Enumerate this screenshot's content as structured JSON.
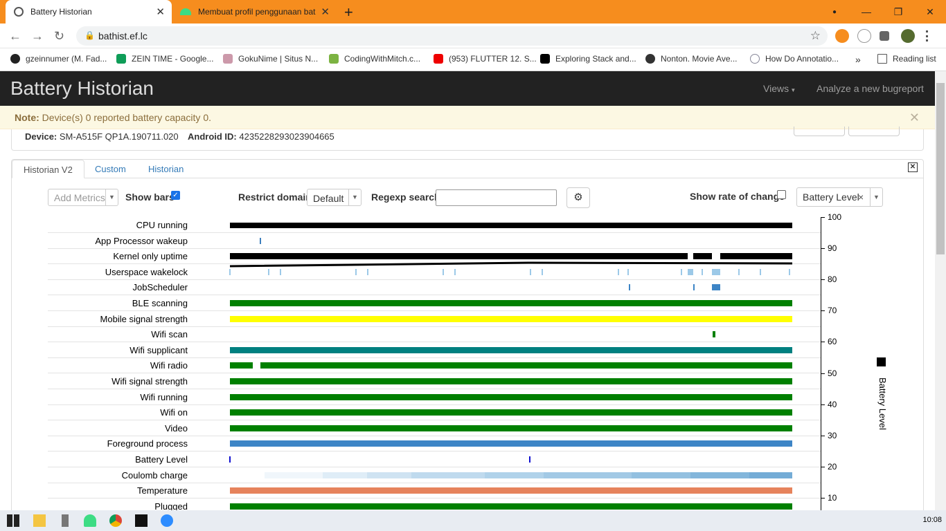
{
  "browser": {
    "tabs": [
      {
        "title": "Battery Historian",
        "active": true
      },
      {
        "title": "Membuat profil penggunaan bat",
        "active": false
      }
    ],
    "url": "bathist.ef.lc",
    "bookmarks": [
      "gzeinnumer (M. Fad...",
      "ZEIN TIME - Google...",
      "GokuNime | Situs N...",
      "CodingWithMitch.c...",
      "(953) FLUTTER 12. S...",
      "Exploring Stack and...",
      "Nonton. Movie Ave...",
      "How Do Annotatio...",
      "»",
      "Reading list"
    ]
  },
  "app": {
    "brand": "Battery Historian",
    "nav_views": "Views",
    "nav_analyze": "Analyze a new bugreport",
    "alert": {
      "strong": "Note:",
      "text": "Device(s) 0 reported battery capacity 0."
    },
    "device_label": "Device:",
    "device_value": "SM-A515F QP1A.190711.020",
    "android_id_label": "Android ID:",
    "android_id_value": "4235228293023904665"
  },
  "tabs": [
    "Historian V2",
    "Custom",
    "Historian"
  ],
  "controls": {
    "add_metrics": "Add Metrics",
    "show_bars": "Show bars",
    "show_bars_checked": true,
    "restrict_domain": "Restrict domain",
    "domain_value": "Default",
    "regexp_search": "Regexp search",
    "regexp_value": "",
    "show_rate": "Show rate of change",
    "show_rate_checked": false,
    "metric_value": "Battery Level"
  },
  "rows": [
    "CPU running",
    "App Processor wakeup",
    "Kernel only uptime",
    "Userspace wakelock",
    "JobScheduler",
    "BLE scanning",
    "Mobile signal strength",
    "Wifi scan",
    "Wifi supplicant",
    "Wifi radio",
    "Wifi signal strength",
    "Wifi running",
    "Wifi on",
    "Video",
    "Foreground process",
    "Battery Level",
    "Coulomb charge",
    "Temperature",
    "Plugged"
  ],
  "y_axis": {
    "label": "Battery Level",
    "ticks": [
      "100",
      "90",
      "80",
      "70",
      "60",
      "50",
      "40",
      "30",
      "20",
      "10"
    ]
  },
  "colors": {
    "green": "#008000",
    "yellow": "#ffff00",
    "teal": "#008080",
    "blue": "#3d85c6",
    "orange": "#e6835c",
    "black": "#000000",
    "accent": "#f68d1e"
  },
  "taskbar": {
    "time": "10:08"
  }
}
